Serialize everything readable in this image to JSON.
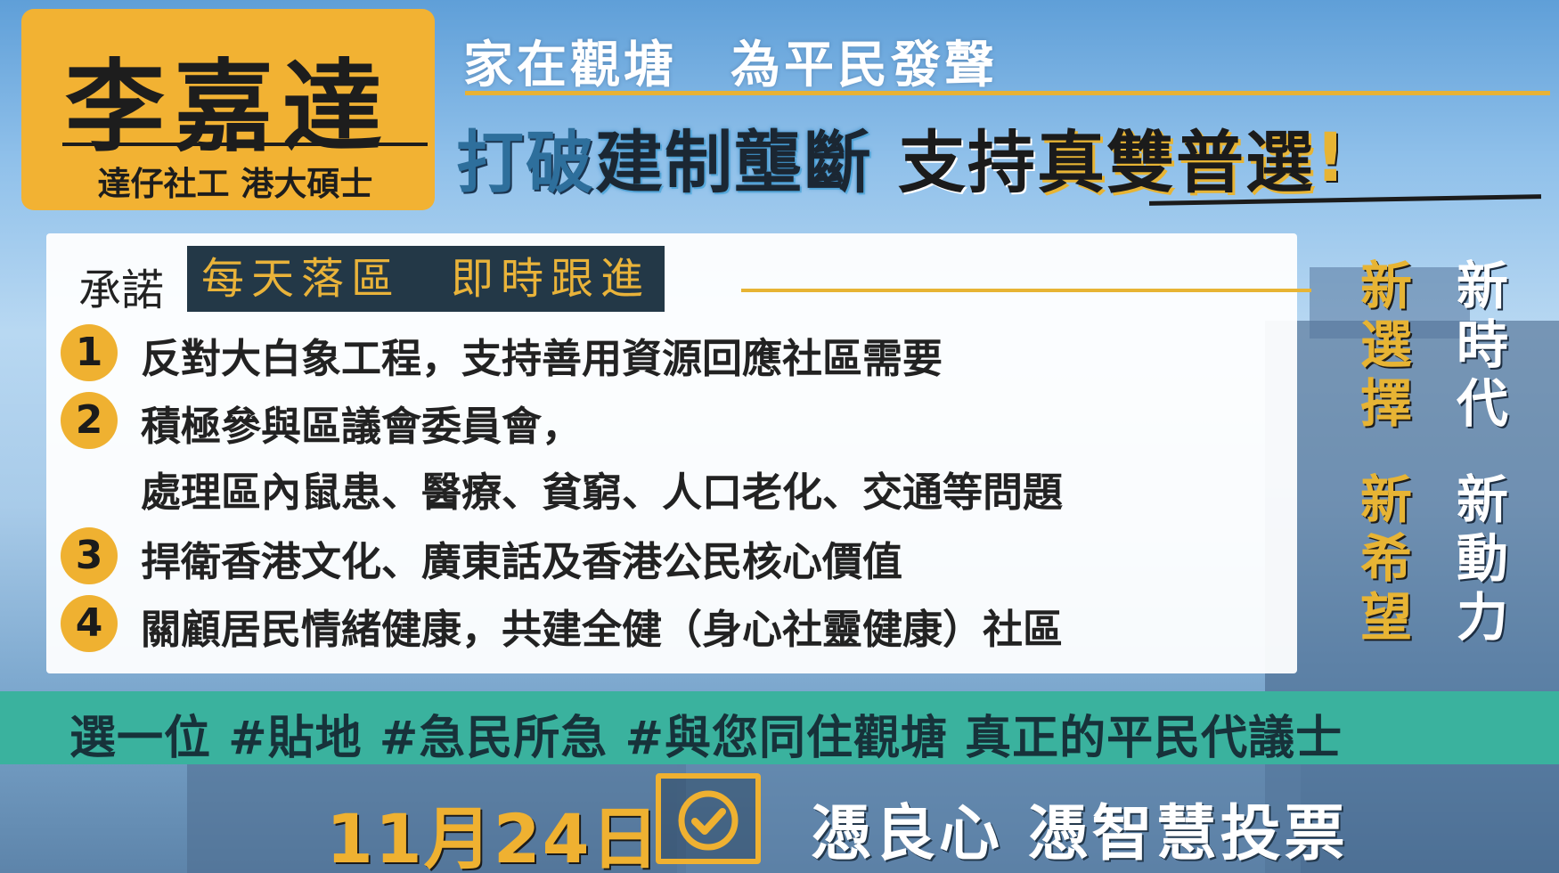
{
  "candidate": {
    "name": "李嘉達",
    "tagline": "達仔社工 港大碩士"
  },
  "header": {
    "slogan_top": "家在觀塘　為平民發聲",
    "slogan_main": {
      "part1": "打破",
      "part2": "建制壟斷",
      "part3": "支持",
      "part4": "真雙普選",
      "part5": "!"
    }
  },
  "pledges": {
    "label": "承諾",
    "highlight": "每天落區　即時跟進",
    "items": [
      {
        "number": "1",
        "lines": [
          "反對大白象工程，支持善用資源回應社區需要"
        ]
      },
      {
        "number": "2",
        "lines": [
          "積極參與區議會委員會，",
          "處理區內鼠患、醫療、貧窮、人口老化、交通等問題"
        ]
      },
      {
        "number": "3",
        "lines": [
          "捍衛香港文化、廣東話及香港公民核心價值"
        ]
      },
      {
        "number": "4",
        "lines": [
          "關顧居民情緒健康，共建全健（身心社靈健康）社區"
        ]
      }
    ]
  },
  "side_taglines": {
    "col_choice": [
      "新",
      "選",
      "擇"
    ],
    "col_era": [
      "新",
      "時",
      "代"
    ],
    "col_hope": [
      "新",
      "希",
      "望"
    ],
    "col_drive": [
      "新",
      "動",
      "力"
    ]
  },
  "banner": {
    "text": "選一位 #貼地 #急民所急 #與您同住觀塘 真正的平民代議士"
  },
  "footer": {
    "date": "11月24日",
    "ballot_icon": "check-ballot-icon",
    "slogan": "憑良心 憑智慧投票"
  },
  "colors": {
    "accent_yellow": "#efb131",
    "banner_teal": "#3ab29e",
    "dark_navy": "#233847",
    "sky_blue": "#8fc0ea"
  }
}
